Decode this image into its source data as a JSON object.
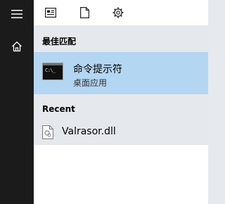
{
  "sidebar": {
    "menu_icon": "hamburger-menu-icon",
    "home_icon": "home-icon"
  },
  "toolbar": {
    "icons": [
      "news-feed-icon",
      "document-icon",
      "gear-icon"
    ]
  },
  "best_match": {
    "header": "最佳匹配",
    "title": "命令提示符",
    "subtitle": "桌面应用",
    "icon": "command-prompt-icon"
  },
  "recent": {
    "header": "Recent",
    "items": [
      {
        "label": "Valrasor.dll",
        "icon": "dll-file-icon"
      }
    ]
  },
  "colors": {
    "rail": "#1b1b1b",
    "selection": "#b3d6f2",
    "panel": "#e5e8ec"
  }
}
